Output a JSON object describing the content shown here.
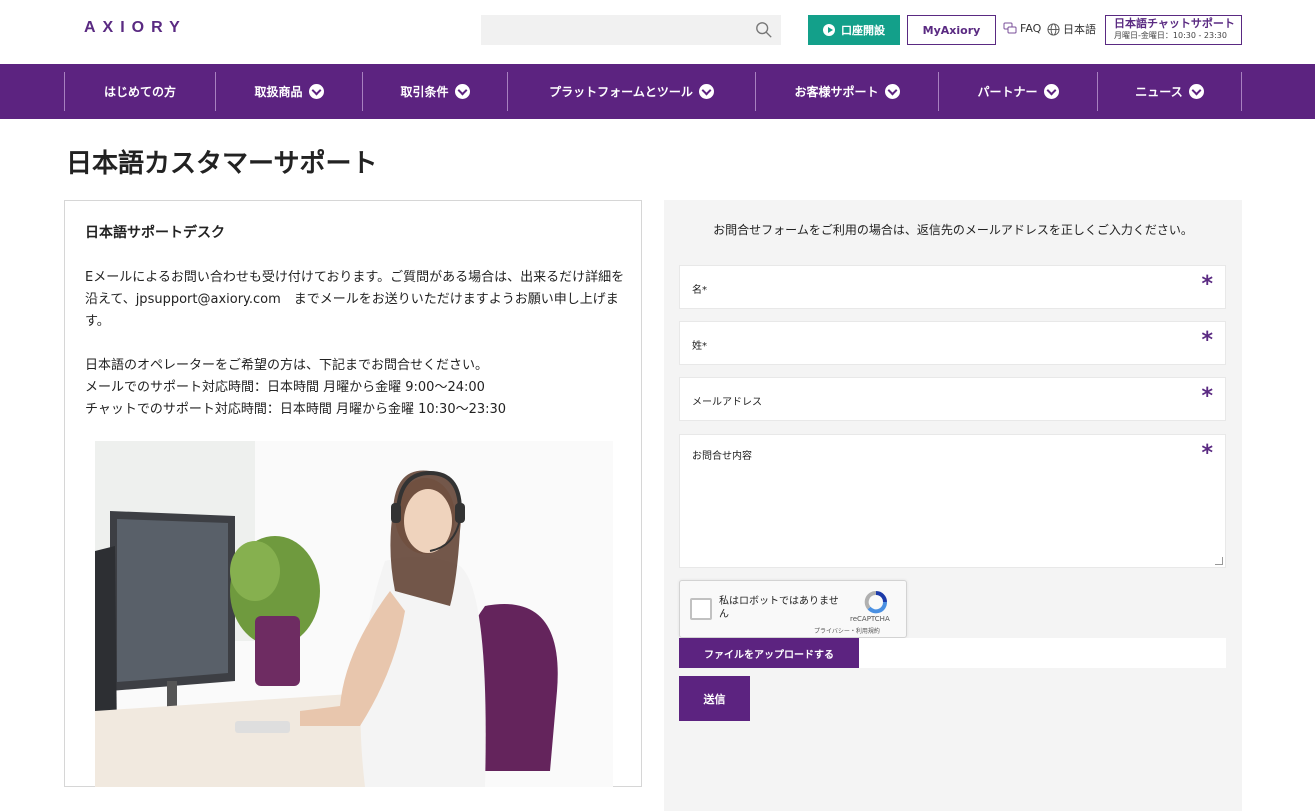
{
  "header": {
    "logo": "AXIORY",
    "search_placeholder": "",
    "open_account_label": "口座開設",
    "myaxiory_label": "MyAxiory",
    "faq_label": "FAQ",
    "language_label": "日本語",
    "chat_title": "日本語チャットサポート",
    "chat_hours": "月曜日-金曜日：10:30 - 23:30"
  },
  "nav": {
    "items": [
      {
        "label": "はじめての方"
      },
      {
        "label": "取扱商品"
      },
      {
        "label": "取引条件"
      },
      {
        "label": "プラットフォームとツール"
      },
      {
        "label": "お客様サポート"
      },
      {
        "label": "パートナー"
      },
      {
        "label": "ニュース"
      }
    ]
  },
  "page": {
    "title": "日本語カスタマーサポート"
  },
  "support_card": {
    "title": "日本語サポートデスク",
    "paragraph1": "Eメールによるお問い合わせも受け付けております。ご質問がある場合は、出来るだけ詳細を沿えて、jpsupport@axiory.com　までメールをお送りいただけますようお願い申し上げます。",
    "line1": "日本語のオペレーターをご希望の方は、下記までお問合せください。",
    "line2": "メールでのサポート対応時間：日本時間 月曜から金曜 9:00〜24:00",
    "line3": "チャットでのサポート対応時間：日本時間 月曜から金曜 10:30〜23:30"
  },
  "form": {
    "note": "お問合せフォームをご利用の場合は、返信先のメールアドレスを正しくご入力ください。",
    "first_name_label": "名*",
    "last_name_label": "姓*",
    "email_label": "メールアドレス",
    "message_label": "お問合せ内容",
    "required_mark": "*",
    "captcha_label": "私はロボットではありません",
    "captcha_brand": "reCAPTCHA",
    "captcha_links": "プライバシー・利用規約",
    "upload_label": "ファイルをアップロードする",
    "submit_label": "送信"
  },
  "colors": {
    "brand_purple": "#5c2380",
    "accent_green": "#13a08a"
  }
}
